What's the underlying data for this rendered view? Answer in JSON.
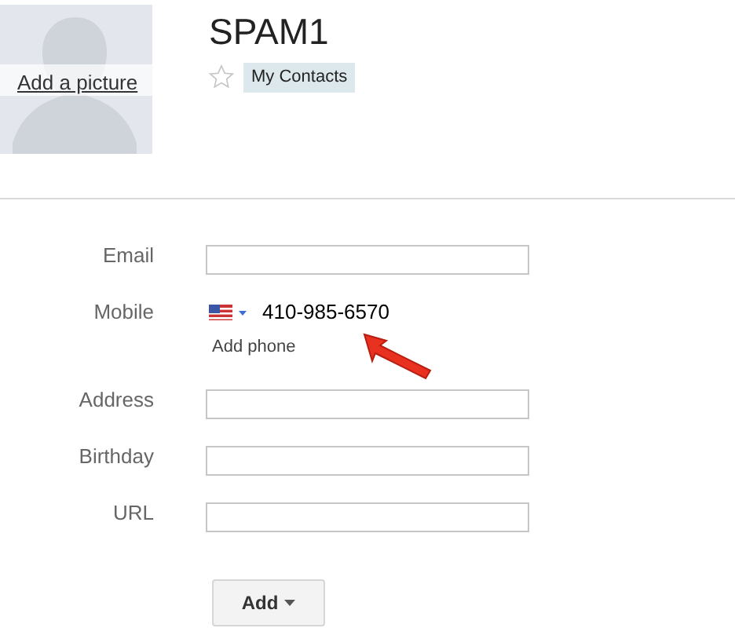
{
  "photo": {
    "link": "Add a picture"
  },
  "contact": {
    "name": "SPAM1",
    "starred": false,
    "groups": [
      "My Contacts"
    ]
  },
  "fields": [
    {
      "kind": "text",
      "label": "Email"
    },
    {
      "kind": "phone",
      "label": "Mobile",
      "value": "410-985-6570",
      "add_link": "Add phone"
    },
    {
      "kind": "text",
      "label": "Address"
    },
    {
      "kind": "text",
      "label": "Birthday"
    },
    {
      "kind": "text",
      "label": "URL"
    }
  ],
  "add_button": {
    "label": "Add"
  }
}
